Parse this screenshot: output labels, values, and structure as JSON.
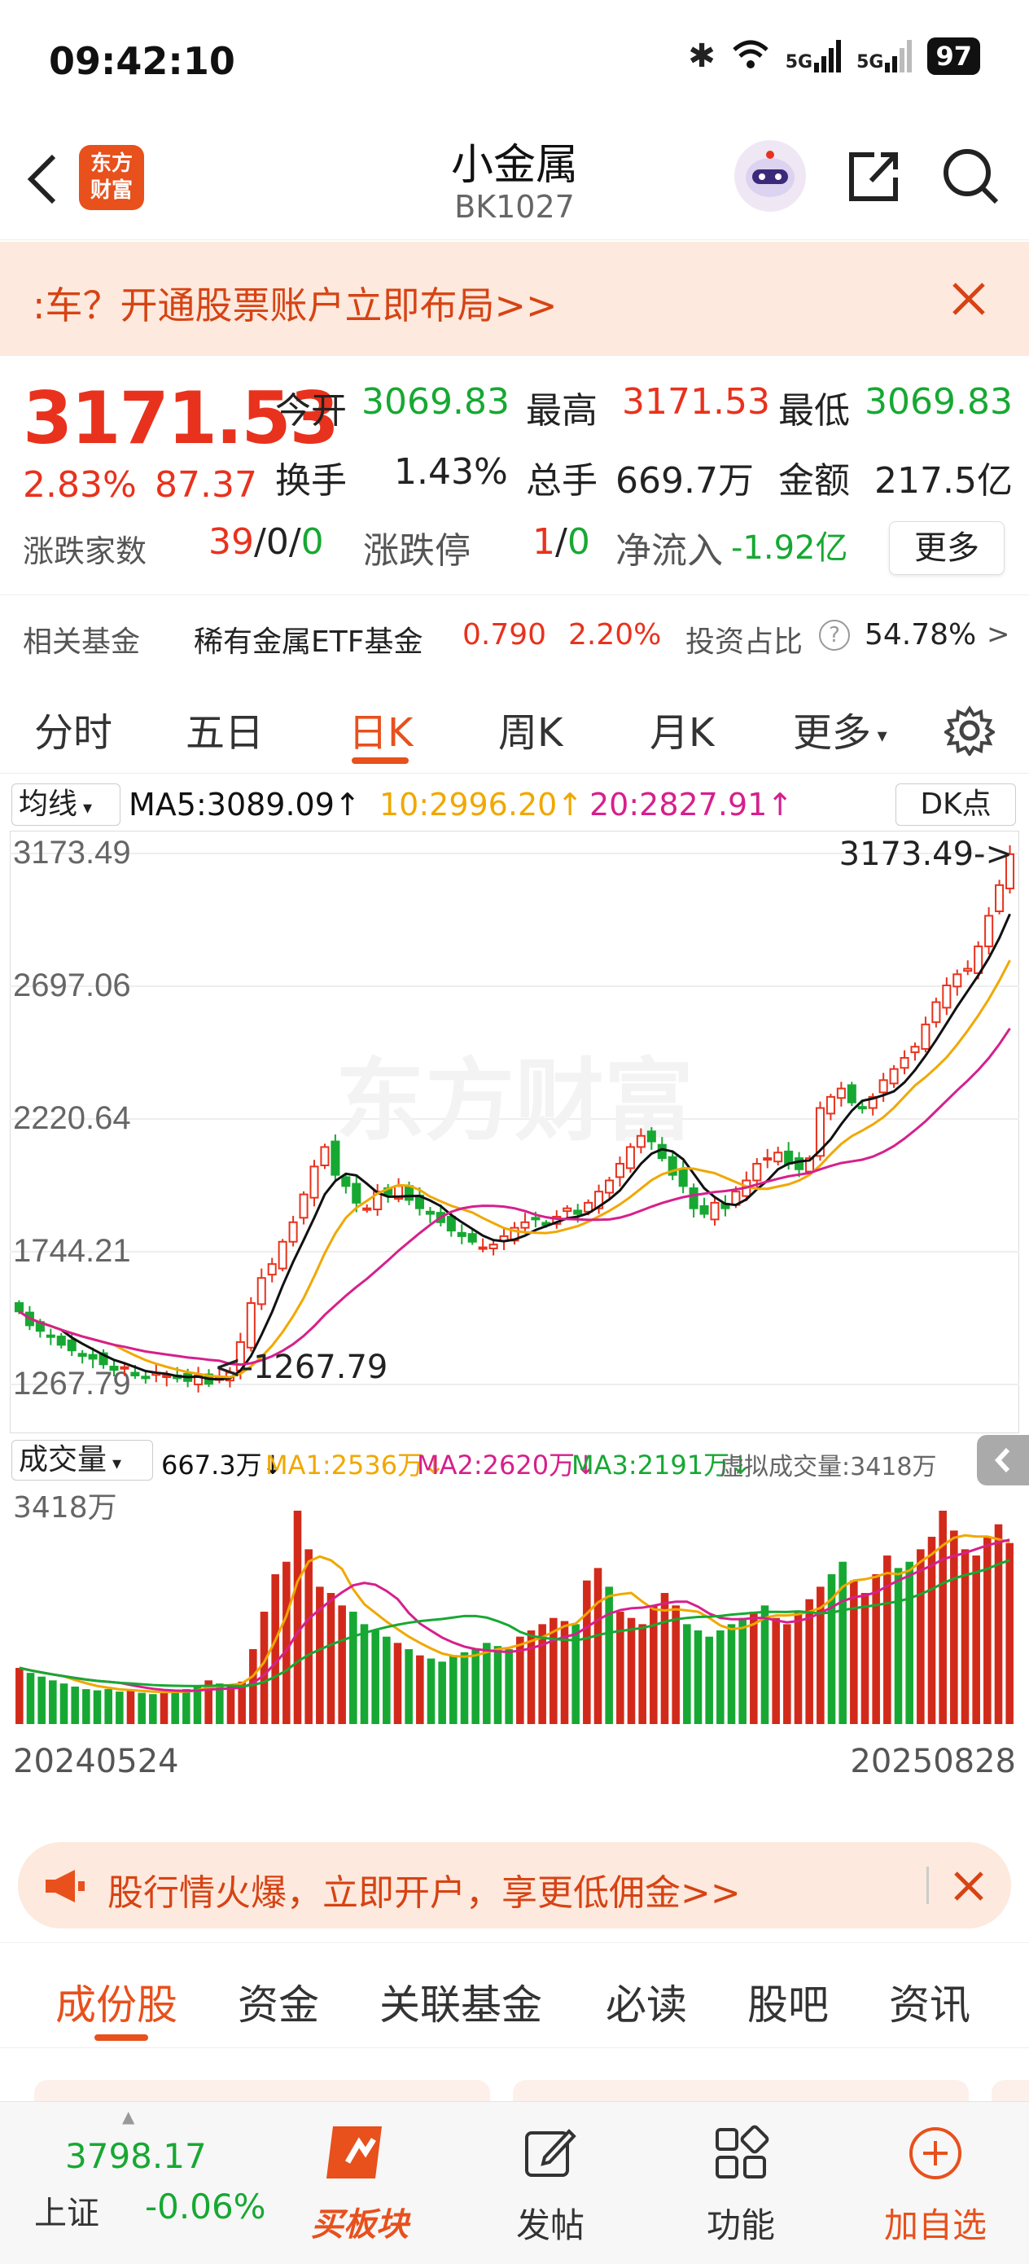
{
  "status_bar": {
    "time": "09:42:10",
    "battery": "97",
    "signal1": "5G",
    "signal2": "5G"
  },
  "header": {
    "title": "小金属",
    "code": "BK1027",
    "logo_text_1": "东方",
    "logo_text_2": "财富"
  },
  "banner_top": {
    "text": ":车？开通股票账户立即布局>>"
  },
  "quote": {
    "price": "3171.53",
    "change_pct": "2.83%",
    "change": "87.37",
    "open_label": "今开",
    "open": "3069.83",
    "high_label": "最高",
    "high": "3171.53",
    "low_label": "最低",
    "low": "3069.83",
    "turnover_label": "换手",
    "turnover": "1.43%",
    "volume_label": "总手",
    "volume": "669.7万",
    "amount_label": "金额",
    "amount": "217.5亿",
    "updown_label": "涨跌家数",
    "up": "39",
    "flat": "0",
    "down": "0",
    "limit_label": "涨跌停",
    "limit_up": "1",
    "limit_down": "0",
    "netflow_label": "净流入",
    "netflow": "-1.92亿",
    "more_label": "更多"
  },
  "fund": {
    "label": "相关基金",
    "name": "稀有金属ETF基金",
    "price": "0.790",
    "pct": "2.20%",
    "ratio_label": "投资占比",
    "ratio": "54.78%",
    "arrow": ">"
  },
  "tabs": {
    "items": [
      "分时",
      "五日",
      "日K",
      "周K",
      "月K",
      "更多"
    ],
    "active": "日K"
  },
  "ma": {
    "selector": "均线",
    "ma5": "MA5:3089.09",
    "ma10": "10:2996.20",
    "ma20": "20:2827.91",
    "dk": "DK点"
  },
  "volume": {
    "selector": "成交量",
    "vol": "667.3万",
    "ma1": "MA1:2536万",
    "ma2": "MA2:2620万",
    "ma3": "MA3:2191万",
    "virtual": "虚拟成交量:3418万",
    "max_label": "3418万"
  },
  "chart_data": {
    "type": "candlestick",
    "y_ticks": [
      "3173.49",
      "2697.06",
      "2220.64",
      "1744.21",
      "1267.79"
    ],
    "ylim": [
      1267.79,
      3173.49
    ],
    "max_marker": "3173.49->",
    "min_marker": "<-1267.79",
    "x_start": "20240524",
    "x_end": "20250828",
    "watermark": "东方财富",
    "close_series": [
      1530,
      1480,
      1460,
      1440,
      1410,
      1390,
      1370,
      1360,
      1340,
      1320,
      1330,
      1300,
      1290,
      1310,
      1300,
      1290,
      1280,
      1300,
      1270,
      1290,
      1310,
      1420,
      1560,
      1650,
      1700,
      1780,
      1850,
      1950,
      2050,
      2120,
      2020,
      1980,
      1920,
      1900,
      1960,
      1950,
      1980,
      1930,
      1900,
      1880,
      1850,
      1820,
      1800,
      1780,
      1760,
      1770,
      1800,
      1830,
      1850,
      1860,
      1840,
      1870,
      1900,
      1880,
      1920,
      1960,
      2000,
      2060,
      2120,
      2160,
      2140,
      2080,
      2020,
      1980,
      1900,
      1880,
      1920,
      1900,
      1960,
      2000,
      2060,
      2080,
      2100,
      2060,
      2040,
      2080,
      2260,
      2300,
      2330,
      2280,
      2260,
      2300,
      2360,
      2400,
      2440,
      2480,
      2560,
      2640,
      2700,
      2740,
      2760,
      2840,
      2950,
      3060,
      3171
    ],
    "volume_series": [
      900,
      820,
      760,
      700,
      650,
      600,
      560,
      540,
      560,
      520,
      540,
      500,
      480,
      520,
      540,
      560,
      600,
      700,
      650,
      620,
      680,
      1200,
      1800,
      2400,
      2600,
      3418,
      2800,
      2200,
      2100,
      1900,
      1800,
      1600,
      1500,
      1400,
      1300,
      1200,
      1100,
      1050,
      1000,
      1100,
      1150,
      1200,
      1300,
      1250,
      1200,
      1400,
      1500,
      1600,
      1700,
      1650,
      1600,
      2300,
      2500,
      2200,
      1800,
      1700,
      1600,
      1900,
      2100,
      1900,
      1600,
      1500,
      1400,
      1500,
      1600,
      1700,
      1800,
      1900,
      1700,
      1600,
      1800,
      2000,
      2200,
      2400,
      2600,
      2300,
      2100,
      2400,
      2700,
      2500,
      2600,
      2800,
      3000,
      3418,
      3100,
      2800,
      2700,
      3000,
      3200,
      2900
    ]
  },
  "banner_mid": {
    "text": "股行情火爆，立即开户，享更低佣金>>"
  },
  "sub_tabs": {
    "items": [
      "成份股",
      "资金",
      "关联基金",
      "必读",
      "股吧",
      "资讯"
    ],
    "active": "成份股"
  },
  "bottom_bar": {
    "index_value": "3798.17",
    "index_name": "上证",
    "index_pct": "-0.06%",
    "buy_label": "买板块",
    "post_label": "发帖",
    "func_label": "功能",
    "add_label": "加自选"
  },
  "colors": {
    "accent": "#e8501c",
    "up": "#e8321d",
    "down": "#17a833",
    "ma5": "#111111",
    "ma10": "#f0a800",
    "ma20": "#d6208c"
  }
}
